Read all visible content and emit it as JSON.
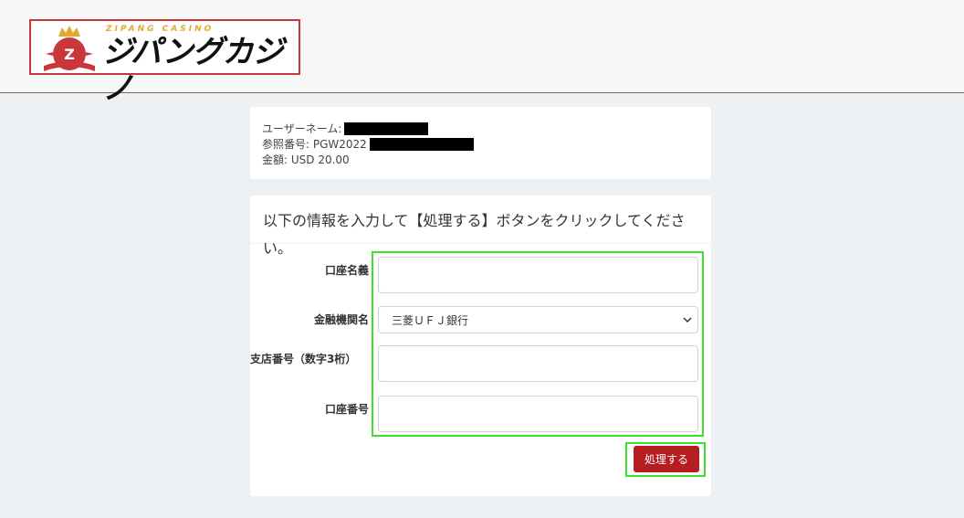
{
  "brand": {
    "small_text": "ZIPANG CASINO",
    "main_text": "ジパングカジノ",
    "accent_color": "#c9373a",
    "gold_color": "#e0a92a"
  },
  "info": {
    "username_label": "ユーザーネーム:",
    "reference_label": "参照番号: PGW2022",
    "amount_label": "金額: USD 20.00"
  },
  "form": {
    "instruction": "以下の情報を入力して【処理する】ボタンをクリックしてください。",
    "account_name_label": "口座名義",
    "account_name_value": "",
    "bank_label": "金融機関名",
    "bank_selected": "三菱ＵＦＪ銀行",
    "branch_label": "支店番号（数字3桁）",
    "branch_value": "",
    "account_number_label": "口座番号",
    "account_number_value": "",
    "submit_label": "処理する",
    "highlight_color": "#3fe02f",
    "button_color": "#b51d20"
  }
}
